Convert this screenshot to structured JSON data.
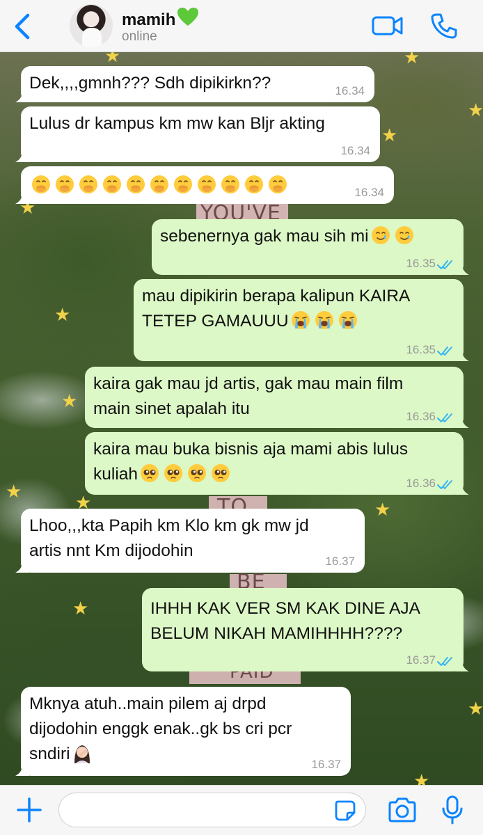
{
  "header": {
    "contact_name": "mamih",
    "status": "online",
    "icons": {
      "back": "chevron-left-icon",
      "heart": "green-heart-emoji",
      "video": "video-camera-icon",
      "call": "phone-icon"
    }
  },
  "background": {
    "sign_words": [
      "YOU'VE",
      "TO",
      "BE",
      "PAID"
    ]
  },
  "messages": [
    {
      "direction": "in",
      "text": "Dek,,,,gmnh??? Sdh dipikirkn??",
      "time": "16.34"
    },
    {
      "direction": "in",
      "text": "Lulus dr kampus km mw kan Bljr akting",
      "time": "16.34"
    },
    {
      "direction": "in",
      "text": "",
      "emoji": "hand-over-mouth-emoji",
      "emoji_count": 11,
      "time": "16.34"
    },
    {
      "direction": "out",
      "text": "sebenernya gak mau sih mi",
      "emoji": "crying-smile-emoji",
      "emoji_count": 2,
      "time": "16.35",
      "read": true
    },
    {
      "direction": "out",
      "text_lines": [
        "mau dipikirin berapa kalipun KAIRA",
        "TETEP GAMAUUU"
      ],
      "emoji": "loudly-crying-emoji",
      "emoji_count": 3,
      "time": "16.35",
      "read": true
    },
    {
      "direction": "out",
      "text_lines": [
        "kaira gak mau jd artis, gak mau main film",
        "main sinet apalah itu"
      ],
      "time": "16.36",
      "read": true
    },
    {
      "direction": "out",
      "text_lines": [
        "kaira mau buka bisnis aja mami abis lulus",
        "kuliah"
      ],
      "emoji": "pleading-face-emoji",
      "emoji_count": 4,
      "time": "16.36",
      "read": true
    },
    {
      "direction": "in",
      "text_lines": [
        "Lhoo,,,kta Papih km Klo km gk mw jd",
        "artis nnt Km dijodohin"
      ],
      "time": "16.37"
    },
    {
      "direction": "out",
      "text_lines": [
        "IHHH KAK VER SM KAK DINE AJA",
        "BELUM NIKAH MAMIHHHH????"
      ],
      "time": "16.37",
      "read": true
    },
    {
      "direction": "in",
      "text_lines": [
        "Mknya atuh..main pilem aj drpd",
        "dijodohin enggk enak..gk bs cri pcr",
        "sndiri"
      ],
      "emoji": "woman-facepalming-emoji",
      "emoji_count": 1,
      "time": "16.37"
    }
  ],
  "footer": {
    "input_value": "",
    "input_placeholder": "",
    "icons": {
      "plus": "plus-icon",
      "sticker": "sticker-icon",
      "camera": "camera-icon",
      "mic": "microphone-icon"
    }
  },
  "colors": {
    "accent": "#0a84ff",
    "incoming": "#ffffff",
    "outgoing": "#dcf8c6",
    "read_ticks": "#34b7f1"
  }
}
